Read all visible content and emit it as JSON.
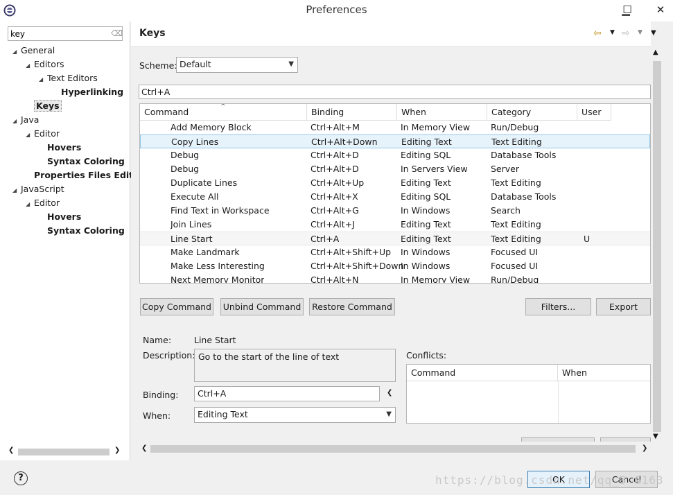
{
  "window": {
    "title": "Preferences",
    "minimize": "▁",
    "maximize": "☐",
    "close": "✕"
  },
  "left": {
    "filter_value": "key",
    "tree": [
      {
        "label": "General",
        "level": 0,
        "expanded": true,
        "bold": false
      },
      {
        "label": "Editors",
        "level": 1,
        "expanded": true,
        "bold": false
      },
      {
        "label": "Text Editors",
        "level": 2,
        "expanded": true,
        "bold": false
      },
      {
        "label": "Hyperlinking",
        "level": 3,
        "bold": true
      },
      {
        "label": "Keys",
        "level": 1,
        "bold": true,
        "selected": true
      },
      {
        "label": "Java",
        "level": 0,
        "expanded": true,
        "bold": false
      },
      {
        "label": "Editor",
        "level": 1,
        "expanded": true,
        "bold": false
      },
      {
        "label": "Hovers",
        "level": 2,
        "bold": true
      },
      {
        "label": "Syntax Coloring",
        "level": 2,
        "bold": true
      },
      {
        "label": "Properties Files Edit",
        "level": 1,
        "bold": true
      },
      {
        "label": "JavaScript",
        "level": 0,
        "expanded": true,
        "bold": false
      },
      {
        "label": "Editor",
        "level": 1,
        "expanded": true,
        "bold": false
      },
      {
        "label": "Hovers",
        "level": 2,
        "bold": true
      },
      {
        "label": "Syntax Coloring",
        "level": 2,
        "bold": true
      }
    ]
  },
  "page": {
    "title": "Keys",
    "scheme_label": "Scheme:",
    "scheme_value": "Default",
    "filter_value": "Ctrl+A",
    "columns": [
      "Command",
      "Binding",
      "When",
      "Category",
      "User"
    ],
    "rows": [
      {
        "command": "Add Memory Block",
        "binding": "Ctrl+Alt+M",
        "when": "In Memory View",
        "category": "Run/Debug",
        "user": ""
      },
      {
        "command": "Copy Lines",
        "binding": "Ctrl+Alt+Down",
        "when": "Editing Text",
        "category": "Text Editing",
        "user": ""
      },
      {
        "command": "Debug",
        "binding": "Ctrl+Alt+D",
        "when": "Editing SQL",
        "category": "Database Tools",
        "user": ""
      },
      {
        "command": "Debug",
        "binding": "Ctrl+Alt+D",
        "when": "In Servers View",
        "category": "Server",
        "user": ""
      },
      {
        "command": "Duplicate Lines",
        "binding": "Ctrl+Alt+Up",
        "when": "Editing Text",
        "category": "Text Editing",
        "user": ""
      },
      {
        "command": "Execute All",
        "binding": "Ctrl+Alt+X",
        "when": "Editing SQL",
        "category": "Database Tools",
        "user": ""
      },
      {
        "command": "Find Text in Workspace",
        "binding": "Ctrl+Alt+G",
        "when": "In Windows",
        "category": "Search",
        "user": ""
      },
      {
        "command": "Join Lines",
        "binding": "Ctrl+Alt+J",
        "when": "Editing Text",
        "category": "Text Editing",
        "user": ""
      },
      {
        "command": "Line Start",
        "binding": "Ctrl+A",
        "when": "Editing Text",
        "category": "Text Editing",
        "user": "U"
      },
      {
        "command": "Make Landmark",
        "binding": "Ctrl+Alt+Shift+Up",
        "when": "In Windows",
        "category": "Focused UI",
        "user": ""
      },
      {
        "command": "Make Less Interesting",
        "binding": "Ctrl+Alt+Shift+Down",
        "when": "In Windows",
        "category": "Focused UI",
        "user": ""
      },
      {
        "command": "Next Memory Monitor",
        "binding": "Ctrl+Alt+N",
        "when": "In Memory View",
        "category": "Run/Debug",
        "user": ""
      }
    ],
    "buttons": {
      "copy": "Copy Command",
      "unbind": "Unbind Command",
      "restore": "Restore Command",
      "filters": "Filters...",
      "export": "Export CSV..."
    },
    "detail": {
      "name_label": "Name:",
      "name_value": "Line Start",
      "desc_label": "Description:",
      "desc_value": "Go to the start of the line of text",
      "binding_label": "Binding:",
      "binding_value": "Ctrl+A",
      "when_label": "When:",
      "when_value": "Editing Text",
      "conflicts_label": "Conflicts:",
      "conflicts_columns": [
        "Command",
        "When"
      ]
    }
  },
  "footer": {
    "help": "?",
    "ok": "OK",
    "cancel": "Cancel",
    "watermark": "https://blog.csdn.net/qq_3 6163"
  }
}
